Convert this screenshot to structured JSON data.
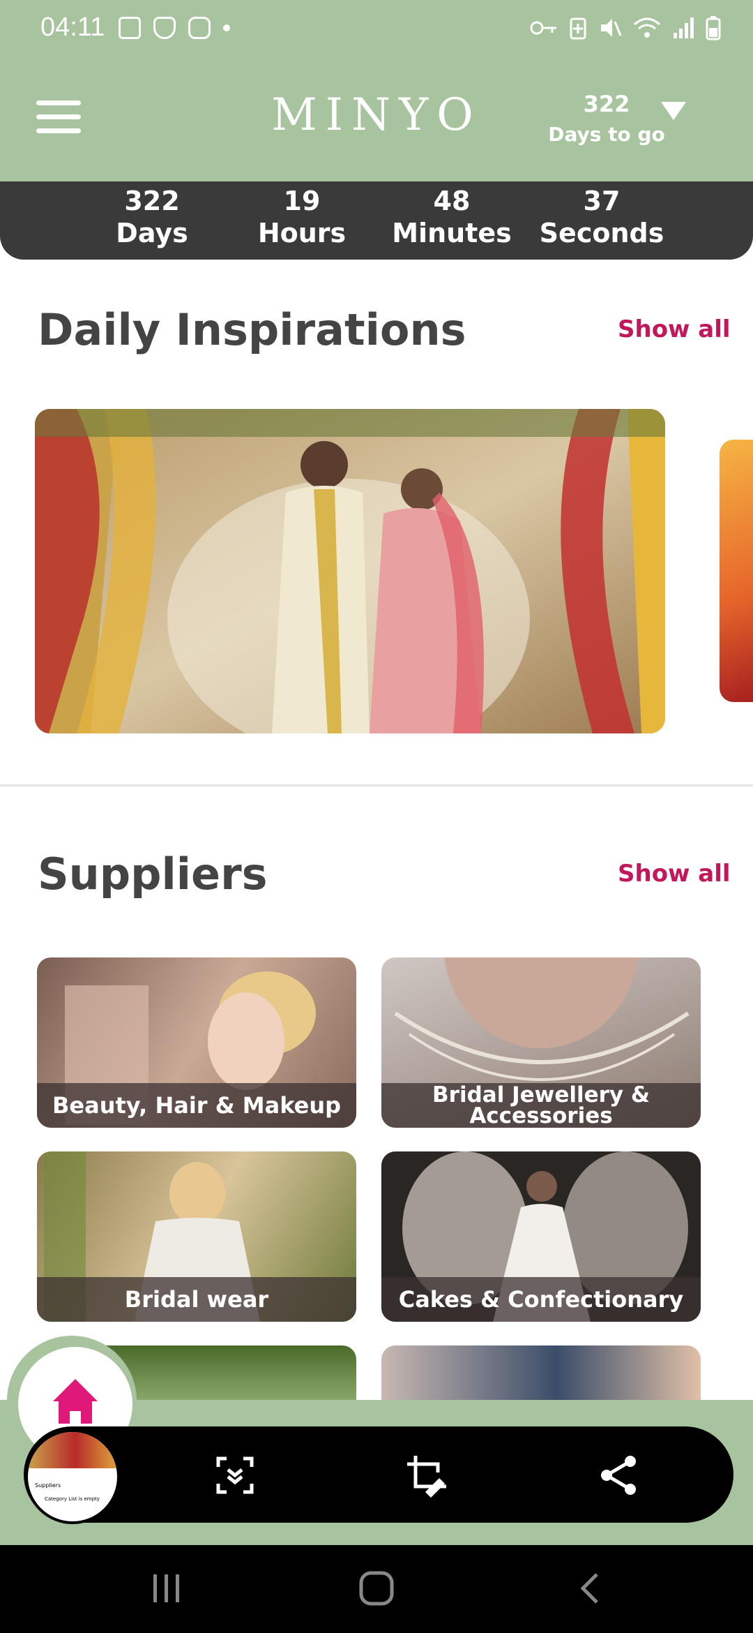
{
  "status_bar": {
    "time": "04:11",
    "left_icons": [
      "image-icon",
      "shield-icon",
      "instagram-icon",
      "dot-icon"
    ],
    "right_icons": [
      "key-icon",
      "battery-saver-icon",
      "mute-icon",
      "wifi-icon",
      "signal-icon",
      "battery-icon"
    ]
  },
  "header": {
    "logo": "MINYO",
    "days_number": "322",
    "days_label": "Days to go"
  },
  "countdown": [
    {
      "value": "322",
      "label": "Days"
    },
    {
      "value": "19",
      "label": "Hours"
    },
    {
      "value": "48",
      "label": "Minutes"
    },
    {
      "value": "37",
      "label": "Seconds"
    }
  ],
  "inspirations": {
    "title": "Daily Inspirations",
    "show_all": "Show all"
  },
  "suppliers": {
    "title": "Suppliers",
    "show_all": "Show all",
    "items": [
      {
        "label": "Beauty, Hair & Makeup"
      },
      {
        "label": "Bridal Jewellery & Accessories"
      },
      {
        "label": "Bridal wear"
      },
      {
        "label": "Cakes & Confectionary"
      }
    ]
  },
  "screenshot_toolbar": {
    "thumb_title": "Suppliers",
    "thumb_empty": "Category List is empty",
    "buttons": [
      "scroll-capture-icon",
      "edit-crop-icon",
      "share-icon"
    ]
  },
  "colors": {
    "brand_green": "#a8c49e",
    "accent": "#c2185b",
    "dark_bar": "#3a3a3a"
  }
}
